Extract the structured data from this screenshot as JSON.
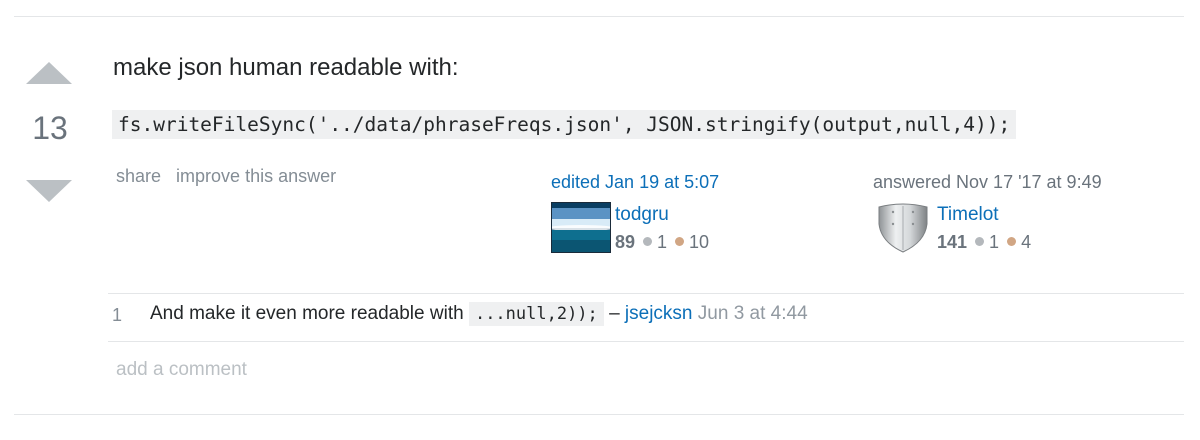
{
  "vote": {
    "score": "13"
  },
  "answer": {
    "text": "make json human readable with:",
    "code": "fs.writeFileSync('../data/phraseFreqs.json', JSON.stringify(output,null,4));"
  },
  "post_menu": {
    "share": "share",
    "improve": "improve this answer"
  },
  "editor": {
    "action": "edited Jan 19 at 5:07",
    "name": "todgru",
    "reputation": "89",
    "silver": "1",
    "bronze": "10"
  },
  "author": {
    "action": "answered Nov 17 '17 at 9:49",
    "name": "Timelot",
    "reputation": "141",
    "silver": "1",
    "bronze": "4"
  },
  "comment": {
    "score": "1",
    "text": "And make it even more readable with",
    "code": "...null,2));",
    "dash": "–",
    "user": "jsejcksn",
    "date": "Jun 3 at 4:44"
  },
  "add_comment": "add a comment",
  "colors": {
    "link": "#0c6fb8",
    "muted": "#6a737c",
    "vote_arrow": "#bbc0c4",
    "code_bg": "#eff0f1",
    "silver_badge": "#b4b8bc",
    "bronze_badge": "#d1a684"
  }
}
